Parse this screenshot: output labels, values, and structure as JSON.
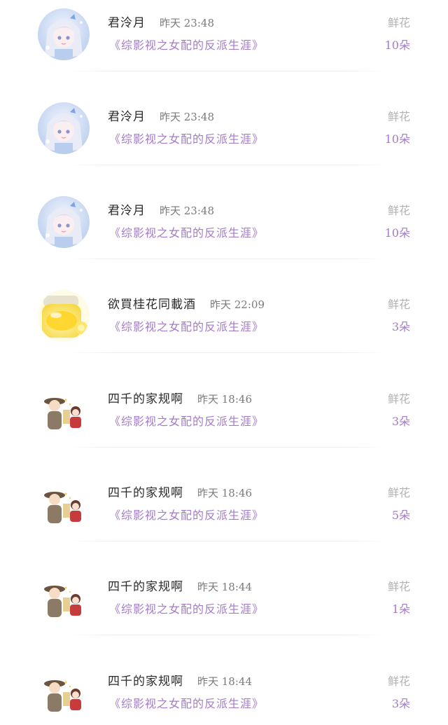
{
  "gift_label": "鲜花",
  "rows": [
    {
      "user": "君泠月",
      "time": "昨天 23:48",
      "book": "《综影视之女配的反派生涯》",
      "count": "10朵",
      "avatar": "anime-girl-avatar"
    },
    {
      "user": "君泠月",
      "time": "昨天 23:48",
      "book": "《综影视之女配的反派生涯》",
      "count": "10朵",
      "avatar": "anime-girl-avatar"
    },
    {
      "user": "君泠月",
      "time": "昨天 23:48",
      "book": "《综影视之女配的反派生涯》",
      "count": "10朵",
      "avatar": "anime-girl-avatar"
    },
    {
      "user": "欲買桂花同載酒",
      "time": "昨天 22:09",
      "book": "《综影视之女配的反派生涯》",
      "count": "3朵",
      "avatar": "honey-jar-avatar"
    },
    {
      "user": "四千的家规啊",
      "time": "昨天 18:46",
      "book": "《综影视之女配的反派生涯》",
      "count": "3朵",
      "avatar": "chibi-duo-avatar"
    },
    {
      "user": "四千的家规啊",
      "time": "昨天 18:46",
      "book": "《综影视之女配的反派生涯》",
      "count": "5朵",
      "avatar": "chibi-duo-avatar"
    },
    {
      "user": "四千的家规啊",
      "time": "昨天 18:44",
      "book": "《综影视之女配的反派生涯》",
      "count": "1朵",
      "avatar": "chibi-duo-avatar"
    },
    {
      "user": "四千的家规啊",
      "time": "昨天 18:44",
      "book": "《综影视之女配的反派生涯》",
      "count": "3朵",
      "avatar": "chibi-duo-avatar"
    }
  ]
}
